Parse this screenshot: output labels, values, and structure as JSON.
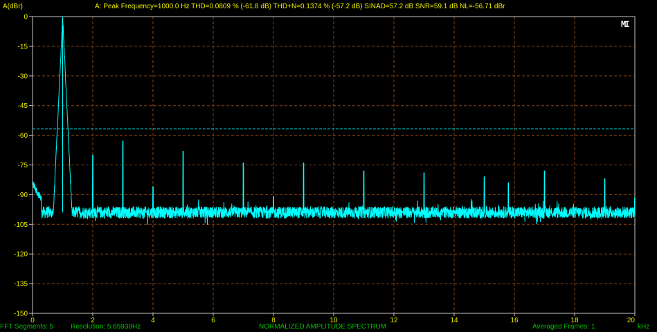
{
  "header": {
    "y_unit": "A(dBr)",
    "readout": "A:  Peak Frequency=1000.0 Hz   THD=0.0809 % (-61.8 dB)   THD+N=0.1374 % (-57.2 dB)   SINAD=57.2 dB   SNR=59.1 dB   NL=-56.71 dBr"
  },
  "footer": {
    "fft_segments": "FFT Segments: 5",
    "resolution": "Resolution:  5.85938Hz",
    "title": "NORMALIZED AMPLITUDE SPECTRUM",
    "averaged": "Averaged Frames:  1",
    "x_unit": "kHz"
  },
  "logo_text": "MI",
  "colors": {
    "background": "#000000",
    "axes": "#c8c8c8",
    "grid": "#8b4513",
    "trace": "#00ffff",
    "noise_level_line": "#00ffff",
    "axis_text": "#f0f000",
    "status_text": "#00c000"
  },
  "chart_data": {
    "type": "line",
    "title": "NORMALIZED AMPLITUDE SPECTRUM",
    "xlabel": "kHz",
    "ylabel": "A(dBr)",
    "xlim": [
      0,
      20
    ],
    "ylim": [
      -150,
      0
    ],
    "x_ticks": [
      "0",
      "2",
      "4",
      "6",
      "8",
      "10",
      "12",
      "14",
      "16",
      "18",
      "20"
    ],
    "y_ticks": [
      "0",
      "-15",
      "-30",
      "-45",
      "-60",
      "-75",
      "-90",
      "-105",
      "-120",
      "-135",
      "-150"
    ],
    "grid": true,
    "noise_level_dBr": -56.71,
    "noise_floor_dBr": -99,
    "series": [
      {
        "peaks": [
          {
            "x": 1.0,
            "y": 0
          },
          {
            "x": 2.0,
            "y": -70
          },
          {
            "x": 3.0,
            "y": -63
          },
          {
            "x": 4.0,
            "y": -86
          },
          {
            "x": 5.0,
            "y": -68
          },
          {
            "x": 7.0,
            "y": -74
          },
          {
            "x": 8.0,
            "y": -91
          },
          {
            "x": 9.0,
            "y": -74
          },
          {
            "x": 11.0,
            "y": -78
          },
          {
            "x": 13.0,
            "y": -79
          },
          {
            "x": 15.0,
            "y": -81
          },
          {
            "x": 15.8,
            "y": -84
          },
          {
            "x": 17.0,
            "y": -78
          },
          {
            "x": 19.0,
            "y": -82
          }
        ]
      }
    ]
  }
}
